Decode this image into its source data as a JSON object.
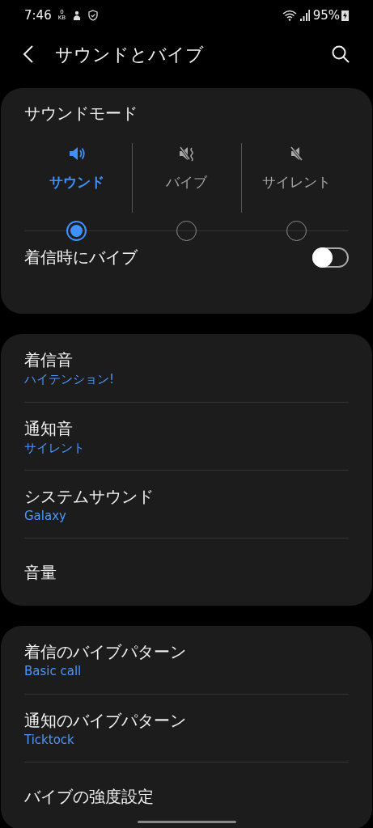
{
  "status_bar": {
    "time": "7:46",
    "data_indicator": {
      "value": "0",
      "unit": "KB"
    },
    "battery": "95%"
  },
  "header": {
    "title": "サウンドとバイブ"
  },
  "sound_mode": {
    "title": "サウンドモード",
    "options": [
      {
        "label": "サウンド",
        "kind": "sound",
        "selected": true
      },
      {
        "label": "バイブ",
        "kind": "vibrate",
        "selected": false
      },
      {
        "label": "サイレント",
        "kind": "mute",
        "selected": false
      }
    ],
    "vibrate_on_ring": {
      "label": "着信時にバイブ",
      "on": false
    }
  },
  "sound_settings": [
    {
      "title": "着信音",
      "subtitle": "ハイテンション!"
    },
    {
      "title": "通知音",
      "subtitle": "サイレント"
    },
    {
      "title": "システムサウンド",
      "subtitle": "Galaxy"
    },
    {
      "title": "音量"
    }
  ],
  "vibration_settings": [
    {
      "title": "着信のバイブパターン",
      "subtitle": "Basic call"
    },
    {
      "title": "通知のバイブパターン",
      "subtitle": "Ticktock"
    },
    {
      "title": "バイブの強度設定"
    }
  ]
}
